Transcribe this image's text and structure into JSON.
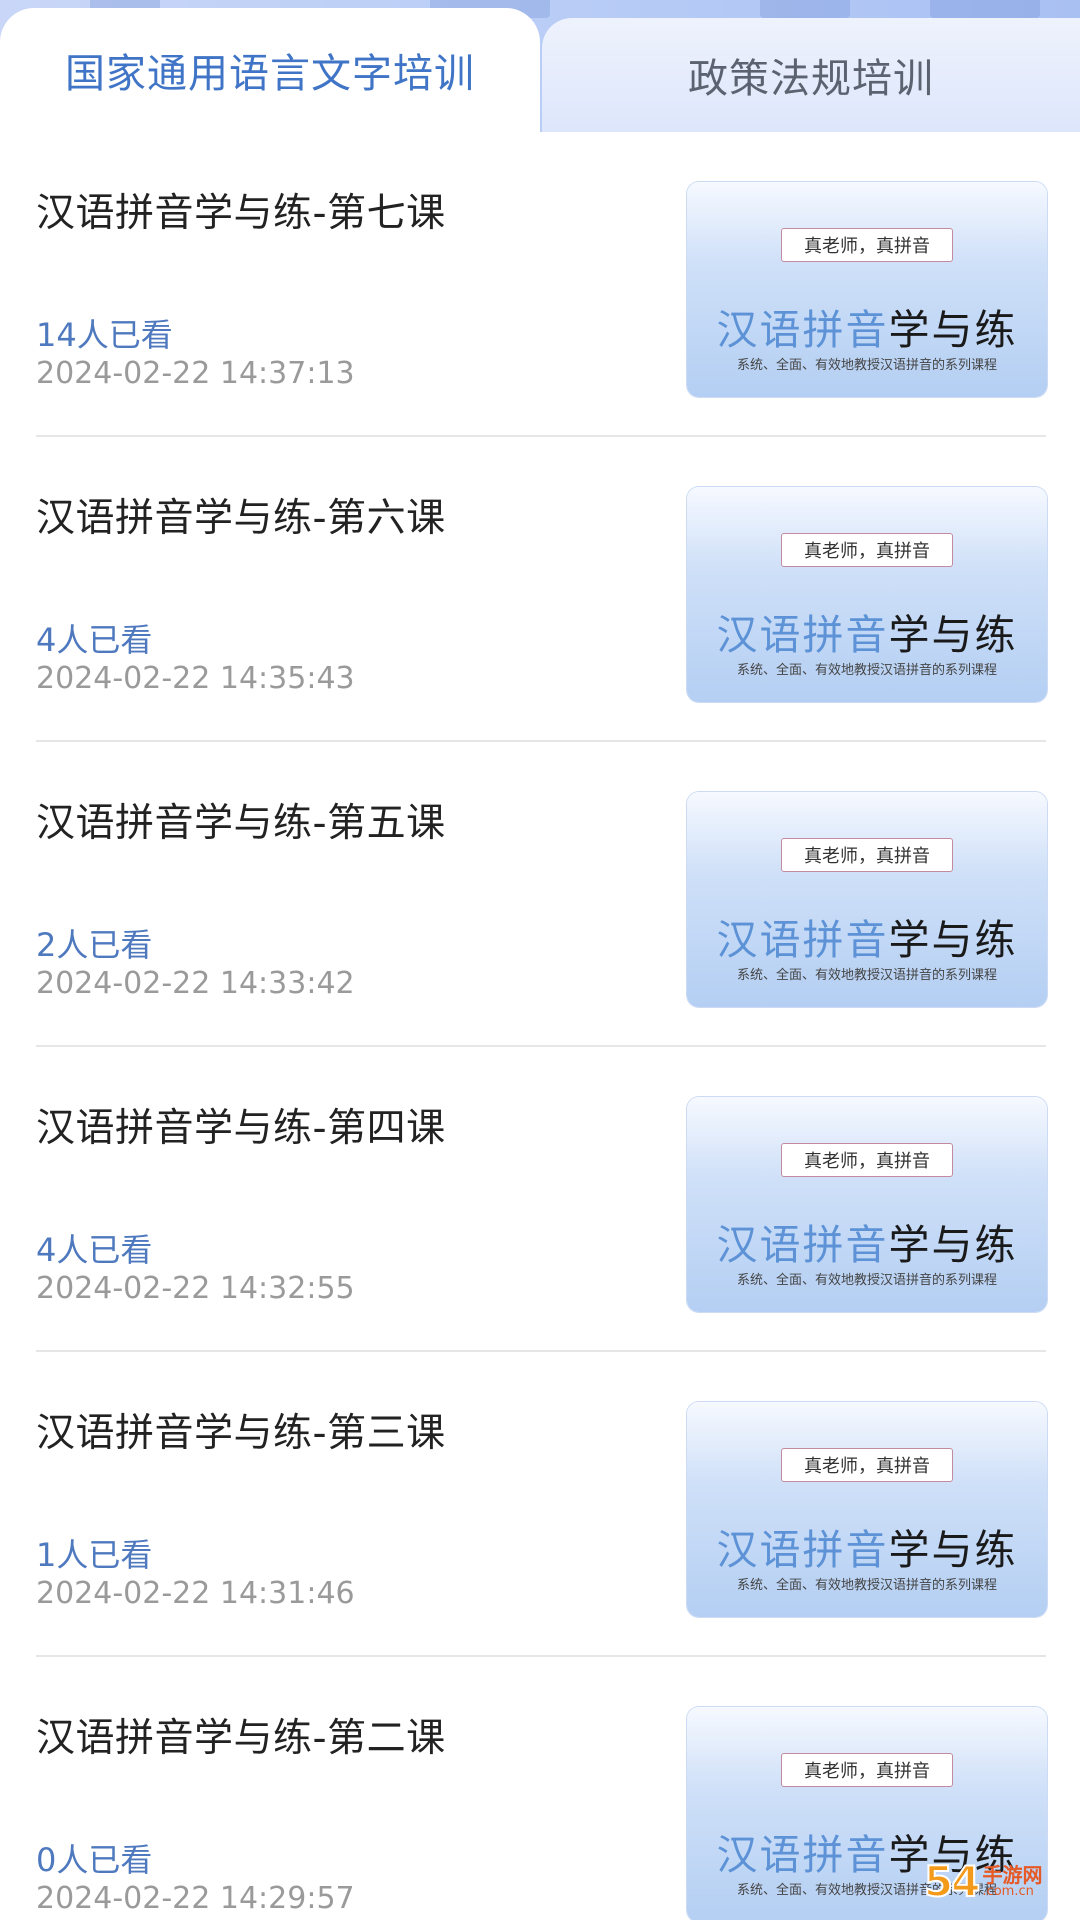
{
  "tabs": {
    "active": "国家通用语言文字培训",
    "inactive": "政策法规培训"
  },
  "thumbnail": {
    "tagline": "真老师，真拼音",
    "big_blue": "汉语拼音",
    "big_dark": "学与练",
    "sub": "系统、全面、有效地教授汉语拼音的系列课程"
  },
  "courses": [
    {
      "title": "汉语拼音学与练-第七课",
      "views": "14人已看",
      "date": "2024-02-22 14:37:13"
    },
    {
      "title": "汉语拼音学与练-第六课",
      "views": "4人已看",
      "date": "2024-02-22 14:35:43"
    },
    {
      "title": "汉语拼音学与练-第五课",
      "views": "2人已看",
      "date": "2024-02-22 14:33:42"
    },
    {
      "title": "汉语拼音学与练-第四课",
      "views": "4人已看",
      "date": "2024-02-22 14:32:55"
    },
    {
      "title": "汉语拼音学与练-第三课",
      "views": "1人已看",
      "date": "2024-02-22 14:31:46"
    },
    {
      "title": "汉语拼音学与练-第二课",
      "views": "0人已看",
      "date": "2024-02-22 14:29:57"
    }
  ],
  "watermark": {
    "number": "54",
    "line1": "手游网",
    "line2": ".com.cn"
  },
  "colors": {
    "active_tab_text": "#3f74c6",
    "views_text": "#4f79bf",
    "date_text": "#9a9a9a"
  }
}
